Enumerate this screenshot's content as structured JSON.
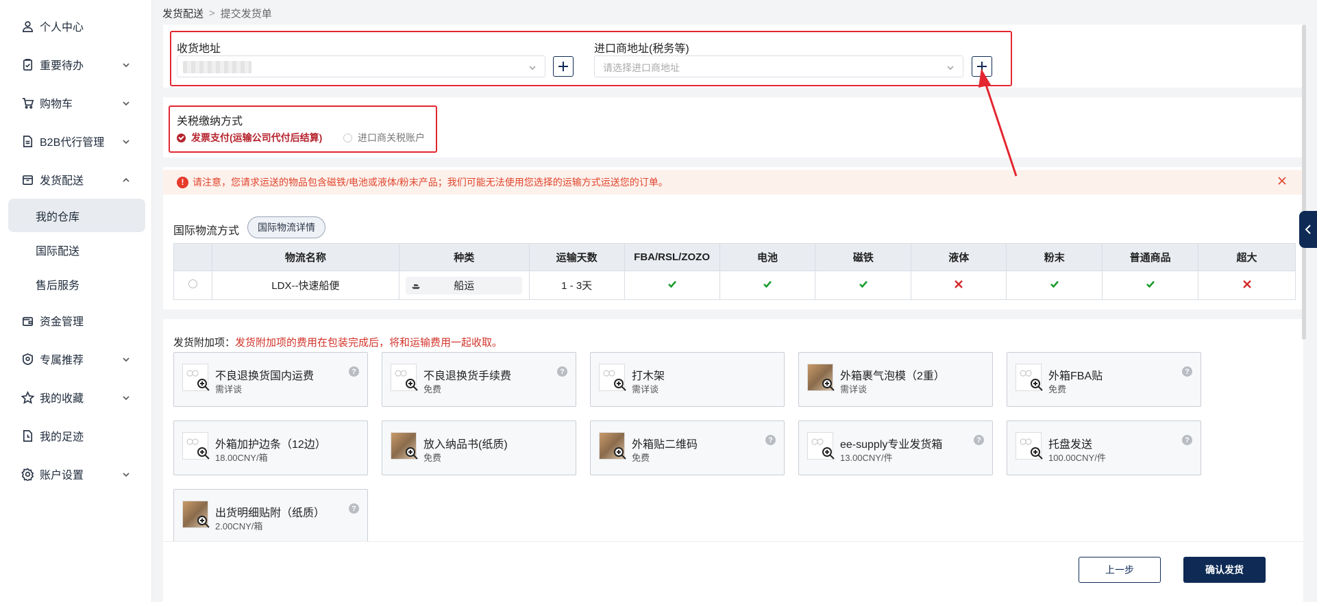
{
  "sidebar": {
    "items": [
      {
        "label": "个人中心",
        "icon": "user-icon"
      },
      {
        "label": "重要待办",
        "icon": "clipboard-icon"
      },
      {
        "label": "购物车",
        "icon": "cart-icon"
      },
      {
        "label": "B2B代行管理",
        "icon": "document-icon"
      },
      {
        "label": "发货配送",
        "icon": "box-icon"
      },
      {
        "label": "资金管理",
        "icon": "wallet-icon"
      },
      {
        "label": "专属推荐",
        "icon": "badge-icon"
      },
      {
        "label": "我的收藏",
        "icon": "star-icon"
      },
      {
        "label": "我的足迹",
        "icon": "history-icon"
      },
      {
        "label": "账户设置",
        "icon": "gear-icon"
      }
    ],
    "subitems": [
      {
        "label": "我的仓库"
      },
      {
        "label": "国际配送"
      },
      {
        "label": "售后服务"
      }
    ]
  },
  "breadcrumb": {
    "parent": "发货配送",
    "separator": ">",
    "current": "提交发货单"
  },
  "address": {
    "shipping_label": "收货地址",
    "importer_label": "进口商地址(税务等)",
    "importer_placeholder": "请选择进口商地址"
  },
  "tax": {
    "label": "关税缴纳方式",
    "option1": "发票支付(运输公司代付后结算)",
    "option2": "进口商关税账户"
  },
  "alert": {
    "icon_text": "!",
    "text": "请注意，您请求运送的物品包含磁铁/电池或液体/粉末产品；我们可能无法使用您选择的运输方式运送您的订单。"
  },
  "logistics": {
    "title": "国际物流方式",
    "detail_button": "国际物流详情",
    "headers": [
      "物流名称",
      "种类",
      "运输天数",
      "FBA/RSL/ZOZO",
      "电池",
      "磁铁",
      "液体",
      "粉末",
      "普通商品",
      "超大"
    ],
    "rows": [
      {
        "name": "LDX--快速船便",
        "type": "船运",
        "days": "1 - 3天",
        "flags": [
          true,
          true,
          true,
          false,
          true,
          true,
          false
        ]
      }
    ]
  },
  "addons": {
    "title": "发货附加项：",
    "note": "发货附加项的费用在包装完成后，将和运输费用一起收取。",
    "cards": [
      {
        "name": "不良退换货国内运费",
        "price": "需详谈",
        "help": "?"
      },
      {
        "name": "不良退换货手续费",
        "price": "免费",
        "help": "?"
      },
      {
        "name": "打木架",
        "price": "需详谈",
        "help": ""
      },
      {
        "name": "外箱裹气泡模（2重）",
        "price": "需详谈",
        "help": ""
      },
      {
        "name": "外箱FBA贴",
        "price": "免费",
        "help": "?"
      },
      {
        "name": "外箱加护边条（12边）",
        "price": "18.00CNY/箱",
        "help": ""
      },
      {
        "name": "放入纳品书(纸质)",
        "price": "免费",
        "help": ""
      },
      {
        "name": "外箱贴二维码",
        "price": "免费",
        "help": "?"
      },
      {
        "name": "ee-supply专业发货箱",
        "price": "13.00CNY/件",
        "help": "?"
      },
      {
        "name": "托盘发送",
        "price": "100.00CNY/件",
        "help": "?"
      },
      {
        "name": "出货明细贴附（纸质）",
        "price": "2.00CNY/箱",
        "help": "?"
      }
    ]
  },
  "footer": {
    "prev": "上一步",
    "confirm": "确认发货"
  },
  "colors": {
    "accent": "#0e2a55",
    "danger": "#e3262f",
    "success": "#1a9a2e"
  }
}
